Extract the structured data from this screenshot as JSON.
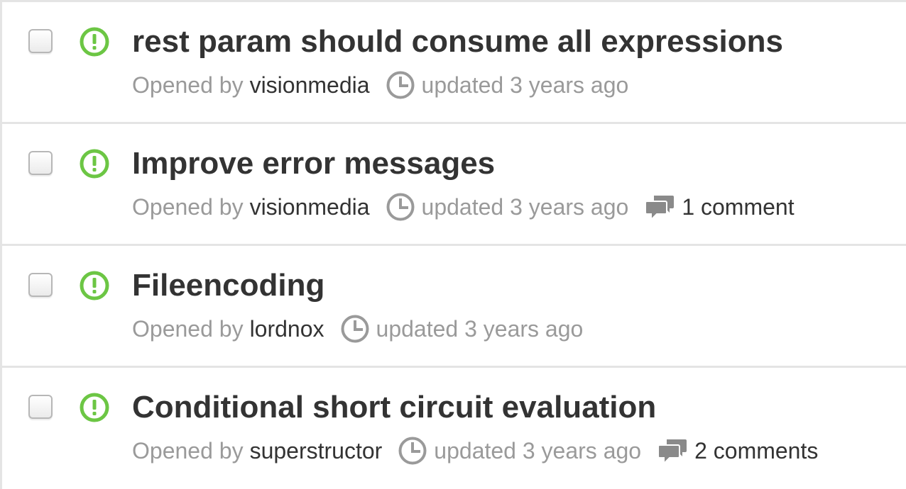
{
  "issues": [
    {
      "title": "rest param should consume all expressions",
      "opened_by_label": "Opened by",
      "author": "visionmedia",
      "updated": "updated 3 years ago",
      "comments": ""
    },
    {
      "title": "Improve error messages",
      "opened_by_label": "Opened by",
      "author": "visionmedia",
      "updated": "updated 3 years ago",
      "comments": "1 comment"
    },
    {
      "title": "Fileencoding",
      "opened_by_label": "Opened by",
      "author": "lordnox",
      "updated": "updated 3 years ago",
      "comments": ""
    },
    {
      "title": "Conditional short circuit evaluation",
      "opened_by_label": "Opened by",
      "author": "superstructor",
      "updated": "updated 3 years ago",
      "comments": "2 comments"
    }
  ],
  "icons": {
    "state": "open-issue-icon",
    "clock": "clock-icon",
    "comment": "comment-icon"
  },
  "colors": {
    "open_state": "#6cc644",
    "title": "#333333",
    "muted": "#9a9a9a",
    "divider": "#e4e4e4"
  }
}
